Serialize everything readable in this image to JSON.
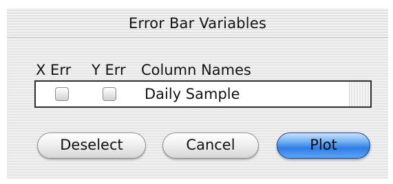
{
  "window": {
    "title": "Error Bar Variables"
  },
  "columns": {
    "x_err": "X Err",
    "y_err": "Y Err",
    "names": "Column Names"
  },
  "rows": [
    {
      "x_err_checked": false,
      "y_err_checked": false,
      "name": "Daily Sample"
    }
  ],
  "buttons": {
    "deselect": "Deselect",
    "cancel": "Cancel",
    "plot": "Plot"
  },
  "colors": {
    "default_button": "#2f7de6"
  }
}
